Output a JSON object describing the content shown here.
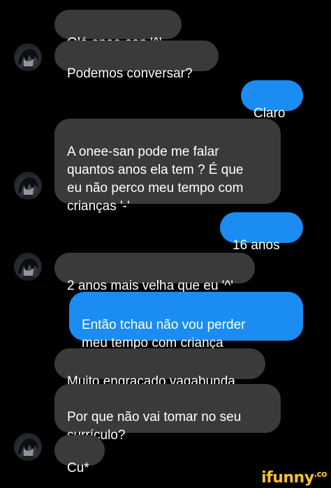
{
  "conversation": {
    "messages": [
      {
        "from": "them",
        "text": "Olá onee-san '^'"
      },
      {
        "from": "them",
        "text": "Podemos conversar?"
      },
      {
        "from": "me",
        "text": "Claro"
      },
      {
        "from": "them",
        "text": "A onee-san pode me falar\nquantos anos ela tem ? É que\neu não perco meu tempo com\ncrianças '-'"
      },
      {
        "from": "me",
        "text": "16 anos"
      },
      {
        "from": "them",
        "text": "2 anos mais velha que eu '^'"
      },
      {
        "from": "me",
        "text": "Então tchau não vou perder\nmeu tempo com criança"
      },
      {
        "from": "them",
        "text": "Muito engraçado vagabunda"
      },
      {
        "from": "them",
        "text": "Por que não vai tomar no seu\ncurrículo?"
      },
      {
        "from": "them",
        "text": "Cu*"
      }
    ]
  },
  "avatar": {
    "icon": "anime-profile-avatar-icon"
  },
  "colors": {
    "background": "#000000",
    "received_bubble": "#3a3a3c",
    "sent_bubble": "#1b8cf2",
    "text": "#ffffff",
    "watermark": "#f2c230"
  },
  "watermark": {
    "text": "ifunny",
    "suffix": ".co"
  }
}
